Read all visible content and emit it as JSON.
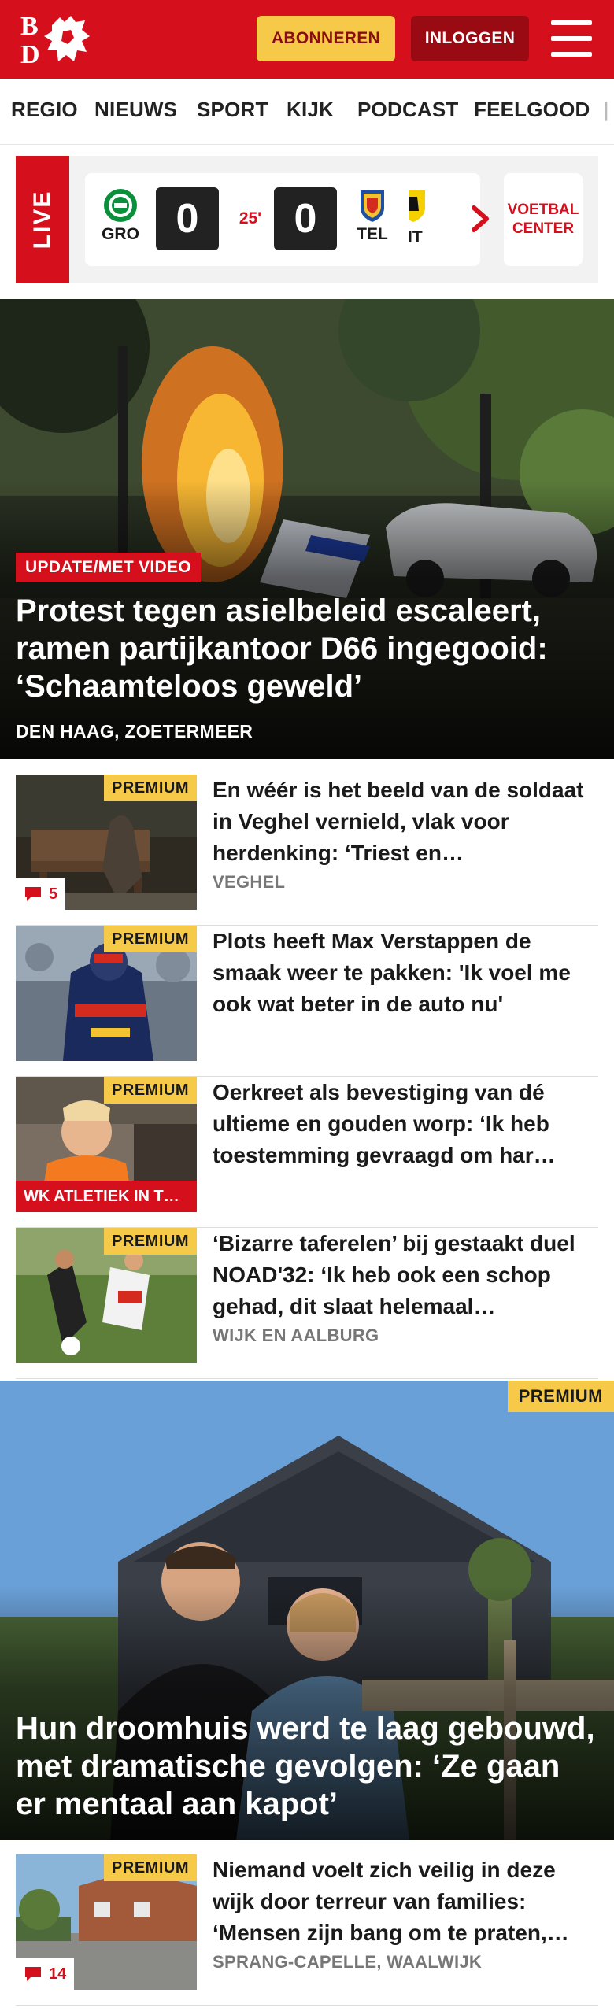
{
  "header": {
    "logo_text": "BD",
    "subscribe_label": "ABONNEREN",
    "login_label": "INLOGGEN",
    "brand_color": "#d50f1b"
  },
  "nav": {
    "items": [
      "REGIO",
      "NIEUWS",
      "SPORT",
      "KIJK",
      "PODCAST",
      "FEELGOOD"
    ]
  },
  "live": {
    "label": "LIVE",
    "match": {
      "home_team": "GRO",
      "home_score": "0",
      "minute": "25'",
      "away_score": "0",
      "away_team": "TEL"
    },
    "next_match_team": "VIT",
    "center_label": "VOETBAL CENTER"
  },
  "hero": {
    "tag": "UPDATE/MET VIDEO",
    "title": "Protest tegen asielbeleid escaleert, ramen partijkantoor D66 ingegooid: ‘Schaamteloos geweld’",
    "location": "DEN HAAG, ZOETERMEER"
  },
  "articles": [
    {
      "premium": "PREMIUM",
      "comments": "5",
      "title": "En wéér is het beeld van de soldaat in Veghel vernield, vlak voor herdenking: ‘Triest en…",
      "location": "VEGHEL"
    },
    {
      "premium": "PREMIUM",
      "title": "Plots heeft Max Verstappen de smaak weer te pakken: 'Ik voel me ook wat beter in de auto nu'"
    },
    {
      "premium": "PREMIUM",
      "tag": "WK ATLETIEK IN T…",
      "title": "Oerkreet als bevestiging van dé ultieme en gouden worp: ‘Ik heb toestemming gevraagd om har…"
    },
    {
      "premium": "PREMIUM",
      "title": "‘Bizarre taferelen’ bij gestaakt duel NOAD'32: ‘Ik heb ook een schop gehad, dit slaat helemaal…",
      "location": "WIJK EN AALBURG"
    },
    {
      "premium": "PREMIUM",
      "comments": "14",
      "title": "Niemand voelt zich veilig in deze wijk door terreur van families: ‘Mensen zijn bang om te praten,…",
      "location": "SPRANG-CAPELLE, WAALWIJK"
    }
  ],
  "feature": {
    "premium": "PREMIUM",
    "title": "Hun droomhuis werd te laag gebouwd, met dramatische gevolgen: ‘Ze gaan er mentaal aan kapot’"
  }
}
